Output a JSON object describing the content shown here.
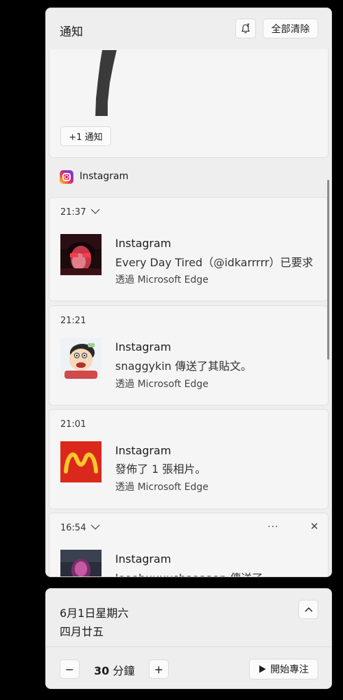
{
  "header": {
    "title": "通知",
    "clear_all_label": "全部清除"
  },
  "previous_group": {
    "more_label": "+1 通知"
  },
  "app_group": {
    "app_name": "Instagram"
  },
  "notifications": [
    {
      "time": "21:37",
      "title": "Instagram",
      "body": "Every Day Tired（@idkarrrrr）已要求",
      "via": "透過 Microsoft Edge"
    },
    {
      "time": "21:21",
      "title": "Instagram",
      "body": "snaggykin 傳送了其貼文。",
      "via": "透過 Microsoft Edge"
    },
    {
      "time": "21:01",
      "title": "Instagram",
      "body": "發佈了 1 張相片。",
      "via": "透過 Microsoft Edge"
    },
    {
      "time": "16:54",
      "title": "Instagram",
      "body": "looobuuuushaaaaan 傳送了",
      "more_label": "···",
      "dismiss_label": "✕"
    }
  ],
  "calendar": {
    "date": "6月1日星期六",
    "lunar": "四月廿五",
    "focus_minutes": "30",
    "focus_unit": "分鐘",
    "decrease_label": "−",
    "increase_label": "+",
    "start_focus_label": "開始專注"
  },
  "icons": {
    "bell": "bell-snooze-icon",
    "app": "instagram-icon",
    "chevron": "chevron-down-icon",
    "collapse": "chevron-up-icon",
    "play": "play-icon"
  }
}
